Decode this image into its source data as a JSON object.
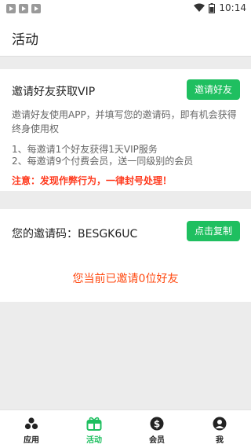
{
  "status_bar": {
    "time": "10:14"
  },
  "app_bar": {
    "title": "活动"
  },
  "invite": {
    "title": "邀请好友获取VIP",
    "button_label": "邀请好友",
    "description": "邀请好友使用APP，并填写您的邀请码，即有机会获得终身使用权",
    "rules": [
      "1、每邀请1个好友获得1天VIP服务",
      "2、每邀请9个付费会员，送一同级别的会员"
    ],
    "warning": "注意：发现作弊行为，一律封号处理！"
  },
  "code_section": {
    "label": "您的邀请码：BESGK6UC",
    "copy_label": "点击复制",
    "invited_count_text": "您当前已邀请0位好友"
  },
  "bottom_nav": {
    "items": [
      {
        "label": "应用",
        "icon": "apps-icon"
      },
      {
        "label": "活动",
        "icon": "gift-icon"
      },
      {
        "label": "会员",
        "icon": "dollar-icon"
      },
      {
        "label": "我",
        "icon": "person-icon"
      }
    ],
    "active_index": 1
  },
  "colors": {
    "accent": "#1fbf60",
    "warning": "#ff3b1f",
    "highlight": "#ff4a12"
  }
}
